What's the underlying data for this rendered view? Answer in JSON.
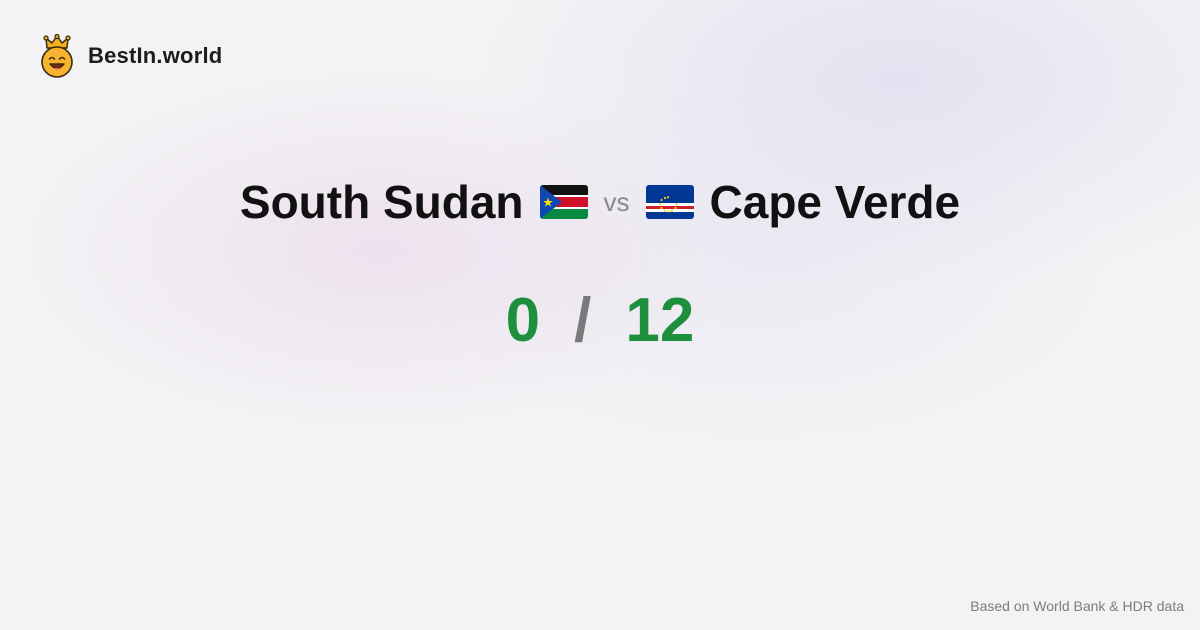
{
  "brand": {
    "name": "BestIn.world",
    "logo_icon": "smiling-crown-icon"
  },
  "comparison": {
    "left_country": "South Sudan",
    "left_flag_icon": "south-sudan-flag-icon",
    "vs_label": "vs",
    "right_flag_icon": "cape-verde-flag-icon",
    "right_country": "Cape Verde"
  },
  "score": {
    "left": "0",
    "separator": "/",
    "right": "12"
  },
  "footer": {
    "source_text": "Based on World Bank & HDR data"
  },
  "colors": {
    "score_green": "#1e8f3d",
    "separator_gray": "#7a7a7a",
    "vs_gray": "#8a8a8a"
  }
}
